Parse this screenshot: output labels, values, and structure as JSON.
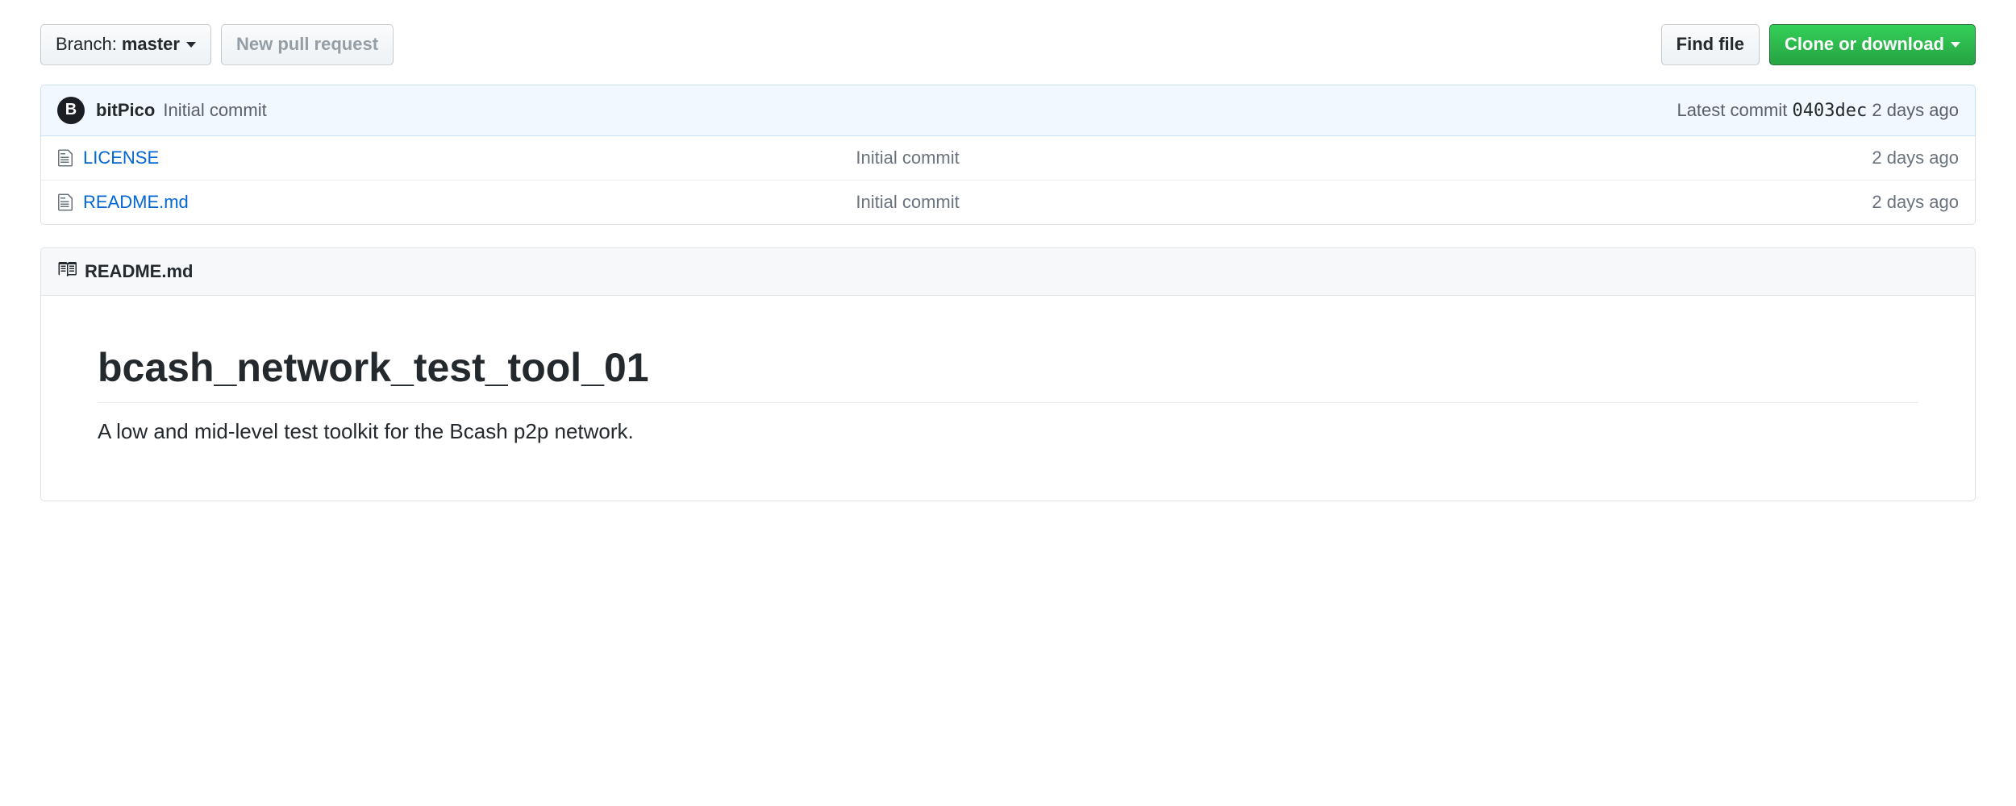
{
  "toolbar": {
    "branch_prefix": "Branch:",
    "branch_name": "master",
    "new_pr_label": "New pull request",
    "find_file_label": "Find file",
    "clone_label": "Clone or download"
  },
  "commit_bar": {
    "avatar_glyph": "B",
    "author": "bitPico",
    "message": "Initial commit",
    "latest_prefix": "Latest commit",
    "sha": "0403dec",
    "age": "2 days ago"
  },
  "files": [
    {
      "name": "LICENSE",
      "commit_message": "Initial commit",
      "age": "2 days ago"
    },
    {
      "name": "README.md",
      "commit_message": "Initial commit",
      "age": "2 days ago"
    }
  ],
  "readme": {
    "filename": "README.md",
    "title": "bcash_network_test_tool_01",
    "description": "A low and mid-level test toolkit for the Bcash p2p network."
  }
}
